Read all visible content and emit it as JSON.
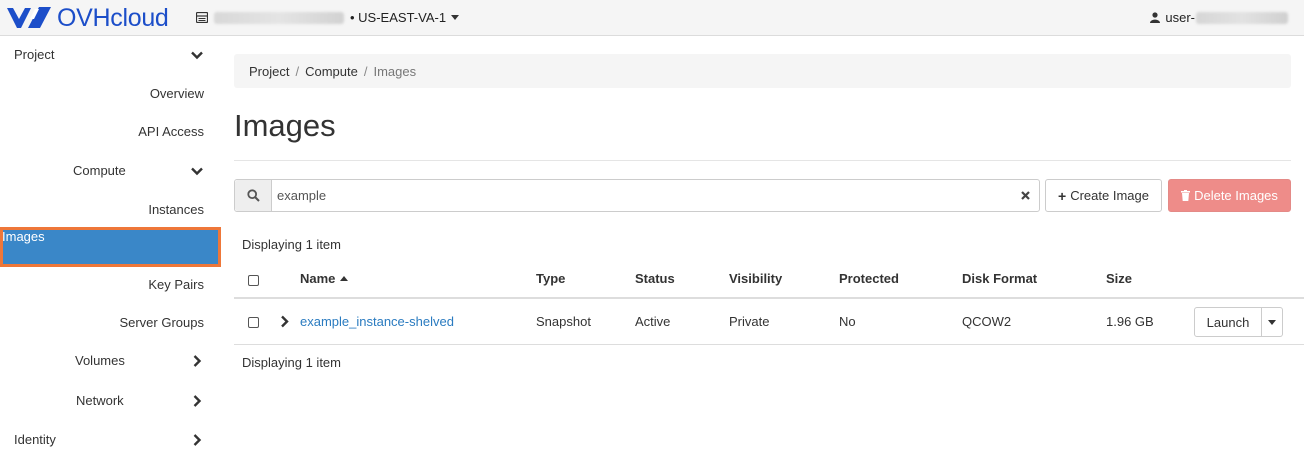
{
  "header": {
    "brand": "OVHcloud",
    "region": "US-EAST-VA-1",
    "user_prefix": "user-"
  },
  "sidebar": {
    "items": [
      {
        "label": "Project",
        "level": 0,
        "chevron": "down"
      },
      {
        "label": "Overview",
        "level": 2
      },
      {
        "label": "API Access",
        "level": 2
      },
      {
        "label": "Compute",
        "level": 1,
        "chevron": "down"
      },
      {
        "label": "Instances",
        "level": 2
      },
      {
        "label": "Images",
        "level": 2,
        "active": true
      },
      {
        "label": "Key Pairs",
        "level": 2
      },
      {
        "label": "Server Groups",
        "level": 2
      },
      {
        "label": "Volumes",
        "level": 1,
        "chevron": "right"
      },
      {
        "label": "Network",
        "level": 1,
        "chevron": "right"
      },
      {
        "label": "Identity",
        "level": 0,
        "chevron": "right"
      }
    ]
  },
  "breadcrumb": {
    "items": [
      "Project",
      "Compute",
      "Images"
    ],
    "separator": "/"
  },
  "page": {
    "title": "Images",
    "count_text_top": "Displaying 1 item",
    "count_text_bottom": "Displaying 1 item"
  },
  "toolbar": {
    "search_value": "example",
    "create_label": "Create Image",
    "delete_label": "Delete Images"
  },
  "table": {
    "columns": [
      "Name",
      "Type",
      "Status",
      "Visibility",
      "Protected",
      "Disk Format",
      "Size"
    ],
    "sorted_column": "Name",
    "rows": [
      {
        "name": "example_instance-shelved",
        "type": "Snapshot",
        "status": "Active",
        "visibility": "Private",
        "protected": "No",
        "disk_format": "QCOW2",
        "size": "1.96 GB",
        "action": "Launch"
      }
    ]
  },
  "colors": {
    "brand": "#1c4ec9",
    "active_nav": "#3a87c8",
    "highlight_outline": "#ee7739",
    "danger": "#ee8c89",
    "link": "#2a7bc0"
  },
  "icons": {
    "logo": "ovh-logo-icon",
    "project": "server-icon",
    "user": "user-icon",
    "search": "search-icon",
    "clear": "close-icon",
    "create": "plus-icon",
    "delete": "trash-icon"
  }
}
